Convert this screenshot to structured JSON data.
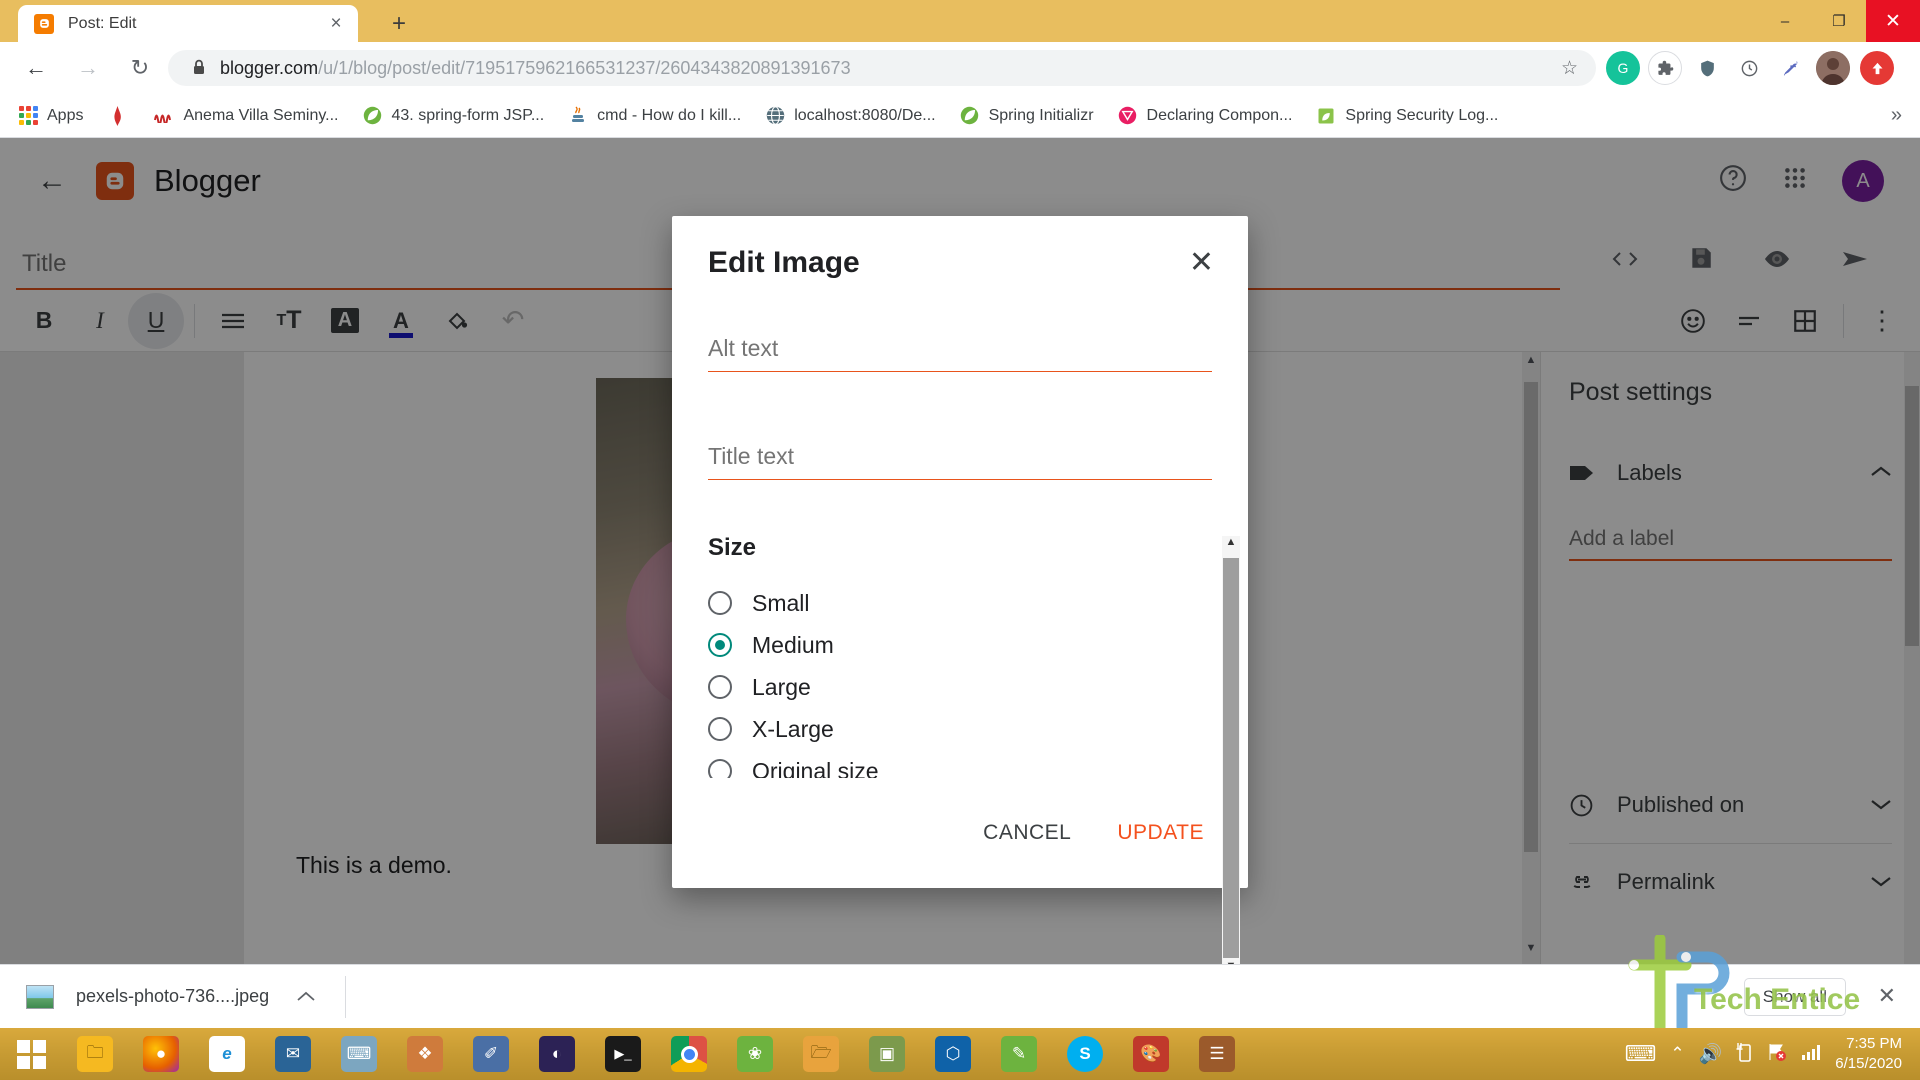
{
  "browser": {
    "tab": {
      "title": "Post: Edit",
      "favicon": "blogger-icon",
      "close_label": "×"
    },
    "new_tab_label": "+",
    "window_controls": {
      "minimize": "–",
      "maximize": "❐",
      "close": "✕"
    },
    "nav": {
      "back": "←",
      "forward": "→",
      "reload": "↻"
    },
    "omnibox": {
      "lock": "🔒",
      "url_domain": "blogger.com",
      "url_path": "/u/1/blog/post/edit/7195175962166531237/2604343820891391673",
      "star": "☆"
    },
    "extensions": [
      {
        "name": "grammarly-extension",
        "glyph": "G",
        "color": "#15C39A"
      },
      {
        "name": "puzzle-extension",
        "glyph": "⚓",
        "color": "#9E9E9E"
      },
      {
        "name": "shield-extension",
        "glyph": "⛨",
        "color": "#5F6368"
      },
      {
        "name": "clock-extension",
        "glyph": "○",
        "color": "#5F6368"
      },
      {
        "name": "eyedropper-extension",
        "glyph": "✎",
        "color": "#5F6368"
      }
    ],
    "profile_initial": "",
    "menu_glyph": "⬆",
    "bookmarks": [
      {
        "label": "Apps",
        "icon": "apps-grid-icon",
        "color": "#4285F4"
      },
      {
        "label": "",
        "icon": "bookmark-icon",
        "color": "#E53935"
      },
      {
        "label": "Anema Villa Seminy...",
        "icon": "anema-icon",
        "color": "#C62828"
      },
      {
        "label": "43. spring-form JSP...",
        "icon": "spring-leaf-icon",
        "color": "#6DB33F"
      },
      {
        "label": "cmd - How do I kill...",
        "icon": "java-icon",
        "color": "#E76F00"
      },
      {
        "label": "localhost:8080/De...",
        "icon": "globe-icon",
        "color": "#5F6368"
      },
      {
        "label": "Spring Initializr",
        "icon": "spring-leaf-icon",
        "color": "#6DB33F"
      },
      {
        "label": "Declaring Compon...",
        "icon": "vaadin-icon",
        "color": "#E91E63"
      },
      {
        "label": "Spring Security Log...",
        "icon": "spring-doc-icon",
        "color": "#6DB33F"
      }
    ],
    "bookmarks_overflow": "»"
  },
  "blogger": {
    "back_arrow": "←",
    "logo_glyph": "B",
    "brand": "Blogger",
    "help_icon": "?",
    "apps_icon": "apps-grid",
    "avatar_initial": "A",
    "title_placeholder": "Title",
    "title_value": "",
    "actions": [
      {
        "name": "html-view-button",
        "glyph": "<>"
      },
      {
        "name": "save-button",
        "glyph": "💾"
      },
      {
        "name": "preview-button",
        "glyph": "👁"
      },
      {
        "name": "publish-button",
        "glyph": "➤"
      }
    ],
    "toolbar": [
      {
        "name": "bold-button",
        "glyph": "B",
        "active": false
      },
      {
        "name": "italic-button",
        "glyph": "I",
        "active": false
      },
      {
        "name": "underline-button",
        "glyph": "U",
        "active": true
      },
      {
        "name": "align-button",
        "glyph": "☰",
        "active": false
      },
      {
        "name": "font-size-button",
        "glyph": "ᴛT",
        "active": false
      },
      {
        "name": "text-background-button",
        "glyph": "A",
        "active": false
      },
      {
        "name": "text-color-button",
        "glyph": "A",
        "active": false
      },
      {
        "name": "fill-color-button",
        "glyph": "◇",
        "active": false
      },
      {
        "name": "undo-button",
        "glyph": "↶",
        "active": false
      }
    ],
    "toolbar_right": [
      {
        "name": "emoji-button",
        "glyph": "☺"
      },
      {
        "name": "line-spacing-button",
        "glyph": "═"
      },
      {
        "name": "table-button",
        "glyph": "⊞"
      },
      {
        "name": "more-options-button",
        "glyph": "⋮"
      }
    ],
    "post_body_text": "This is a demo.",
    "sidebar": {
      "heading": "Post settings",
      "items": [
        {
          "label": "Labels",
          "icon": "label-tag-icon",
          "chevron": "⌃",
          "expanded": true
        },
        {
          "label": "Published on",
          "icon": "clock-icon",
          "chevron": "⌄",
          "expanded": false
        },
        {
          "label": "Permalink",
          "icon": "link-icon",
          "chevron": "⌄",
          "expanded": false
        }
      ],
      "label_input_placeholder": "Add a label",
      "label_input_value": ""
    }
  },
  "modal": {
    "title": "Edit Image",
    "close_glyph": "✕",
    "alt_text": {
      "placeholder": "Alt text",
      "value": ""
    },
    "title_text": {
      "placeholder": "Title text",
      "value": ""
    },
    "size_heading": "Size",
    "size_options": [
      {
        "label": "Small",
        "selected": false
      },
      {
        "label": "Medium",
        "selected": true
      },
      {
        "label": "Large",
        "selected": false
      },
      {
        "label": "X-Large",
        "selected": false
      },
      {
        "label": "Original size",
        "selected": false
      }
    ],
    "selected_size": "Medium",
    "cancel_label": "CANCEL",
    "update_label": "UPDATE",
    "accent_color": "#F4511E",
    "radio_selected_color": "#00897B",
    "scroll_up_glyph": "▲",
    "scroll_down_glyph": "▼"
  },
  "downloads": {
    "file_name": "pexels-photo-736....jpeg",
    "chevron": "⌃",
    "show_all_label": "Show all",
    "close_glyph": "✕"
  },
  "watermark": {
    "text": "Tech Entice"
  },
  "taskbar": {
    "start_label": "start-button",
    "items": [
      {
        "name": "file-explorer",
        "glyph": "🗀",
        "color": "#F5B921"
      },
      {
        "name": "firefox",
        "glyph": "●",
        "color": "#E66000"
      },
      {
        "name": "internet-explorer",
        "glyph": "e",
        "color": "#1E90D6"
      },
      {
        "name": "thunderbird",
        "glyph": "✉",
        "color": "#2A6496"
      },
      {
        "name": "keyboard-app",
        "glyph": "⌨",
        "color": "#7CA6C0"
      },
      {
        "name": "image-tool",
        "glyph": "❖",
        "color": "#CF7B3C"
      },
      {
        "name": "drawing-app",
        "glyph": "✐",
        "color": "#4A6FA5"
      },
      {
        "name": "eclipse",
        "glyph": "◐",
        "color": "#2C2255"
      },
      {
        "name": "terminal",
        "glyph": "▶",
        "color": "#1A1A1A"
      },
      {
        "name": "chrome",
        "glyph": "◉",
        "color": "#DD5144"
      },
      {
        "name": "spring-tool-suite",
        "glyph": "❀",
        "color": "#6DB33F"
      },
      {
        "name": "folder",
        "glyph": "🗁",
        "color": "#E8A33D"
      },
      {
        "name": "photo-viewer",
        "glyph": "▣",
        "color": "#7C9A4C"
      },
      {
        "name": "vs-code",
        "glyph": "⬡",
        "color": "#0F62A8"
      },
      {
        "name": "notepad-plus",
        "glyph": "✎",
        "color": "#6DB33F"
      },
      {
        "name": "skype",
        "glyph": "S",
        "color": "#00AFF0"
      },
      {
        "name": "paint",
        "glyph": "🎨",
        "color": "#C0392B"
      },
      {
        "name": "documents-app",
        "glyph": "☰",
        "color": "#9B5A2B"
      }
    ],
    "tray": {
      "touch_keyboard": "⌨",
      "show_hidden": "⌃",
      "volume": "🔊",
      "battery": "▮",
      "network": "⚑",
      "signal": "▂▄▆",
      "time": "7:35 PM",
      "date": "6/15/2020"
    }
  }
}
